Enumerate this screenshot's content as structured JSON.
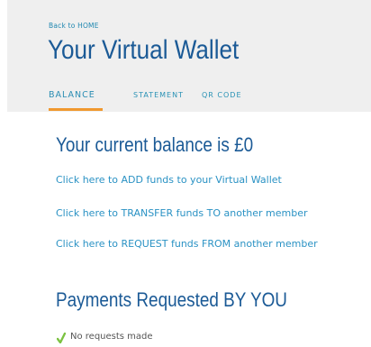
{
  "header": {
    "back_link": "Back to HOME",
    "title": "Your Virtual Wallet",
    "tabs": [
      {
        "label": "BALANCE",
        "active": true
      },
      {
        "label": "STATEMENT",
        "active": false
      },
      {
        "label": "QR CODE",
        "active": false
      }
    ]
  },
  "balance": {
    "heading": "Your current balance is £0",
    "links": [
      "Click here to ADD funds to your Virtual Wallet",
      "Click here to TRANSFER funds TO another member",
      "Click here to REQUEST funds FROM another member"
    ]
  },
  "payments_requested": {
    "heading": "Payments Requested BY YOU",
    "status_icon": "check-icon",
    "status_text": "No requests made"
  },
  "colors": {
    "heading": "#1b5a96",
    "link": "#2a92c4",
    "tab_underline": "#f0982e",
    "header_bg": "#efefef",
    "check": "#7cc242"
  }
}
